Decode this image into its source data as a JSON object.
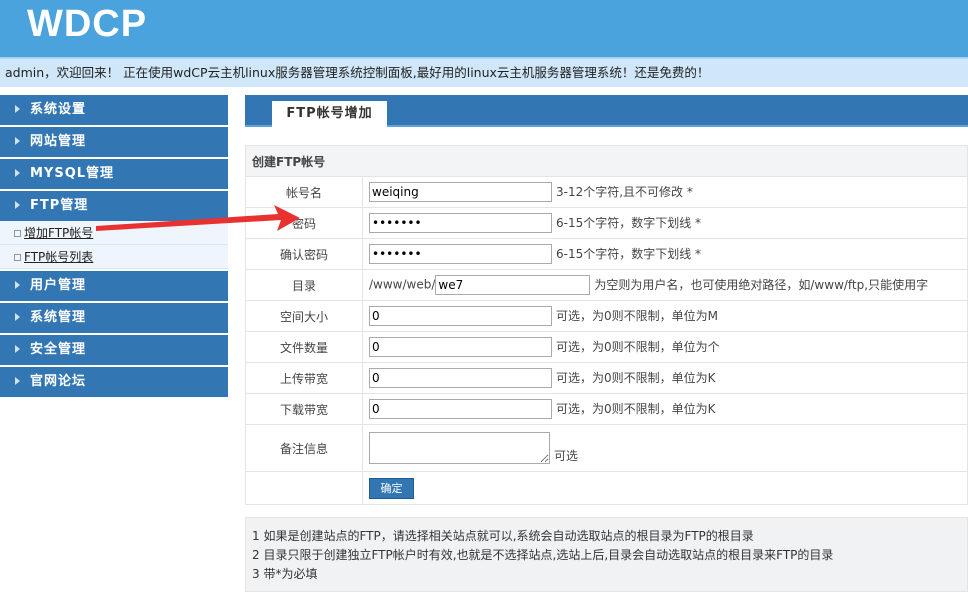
{
  "header": {
    "logo": "WDCP",
    "welcome": "admin，欢迎回来！ 正在使用wdCP云主机linux服务器管理系统控制面板,最好用的linux云主机服务器管理系统！还是免费的！"
  },
  "sidebar": {
    "menu": [
      "系统设置",
      "网站管理",
      "MYSQL管理",
      "FTP管理"
    ],
    "ftp_sub": [
      "增加FTP帐号",
      "FTP帐号列表"
    ],
    "menu2": [
      "用户管理",
      "系统管理",
      "安全管理",
      "官网论坛"
    ]
  },
  "tab": "FTP帐号增加",
  "form": {
    "section": "创建FTP帐号",
    "rows": [
      {
        "label": "帐号名",
        "value": "weiqing",
        "hint": "3-12个字符,且不可修改 *"
      },
      {
        "label": "密码",
        "value": "weiqing",
        "hint": "6-15个字符，数字下划线 *"
      },
      {
        "label": "确认密码",
        "value": "weiqing",
        "hint": "6-15个字符，数字下划线 *"
      },
      {
        "label": "目录",
        "prefix": "/www/web/",
        "value": "we7",
        "hint": "为空则为用户名，也可使用绝对路径，如/www/ftp,只能使用字"
      },
      {
        "label": "空间大小",
        "value": "0",
        "hint": "可选，为0则不限制，单位为M"
      },
      {
        "label": "文件数量",
        "value": "0",
        "hint": "可选，为0则不限制，单位为个"
      },
      {
        "label": "上传带宽",
        "value": "0",
        "hint": "可选，为0则不限制，单位为K"
      },
      {
        "label": "下载带宽",
        "value": "0",
        "hint": "可选，为0则不限制，单位为K"
      },
      {
        "label": "备注信息",
        "value": "",
        "hint": "可选"
      }
    ],
    "submit": "确定"
  },
  "notes": [
    "1 如果是创建站点的FTP，请选择相关站点就可以,系统会自动选取站点的根目录为FTP的根目录",
    "2 目录只限于创建独立FTP帐户时有效,也就是不选择站点,选站上后,目录会自动选取站点的根目录来FTP的目录",
    "3 带*为必填"
  ],
  "colors": {
    "header": "#4aa3dc",
    "menu": "#3277b4",
    "arrow": "#e8322f"
  }
}
